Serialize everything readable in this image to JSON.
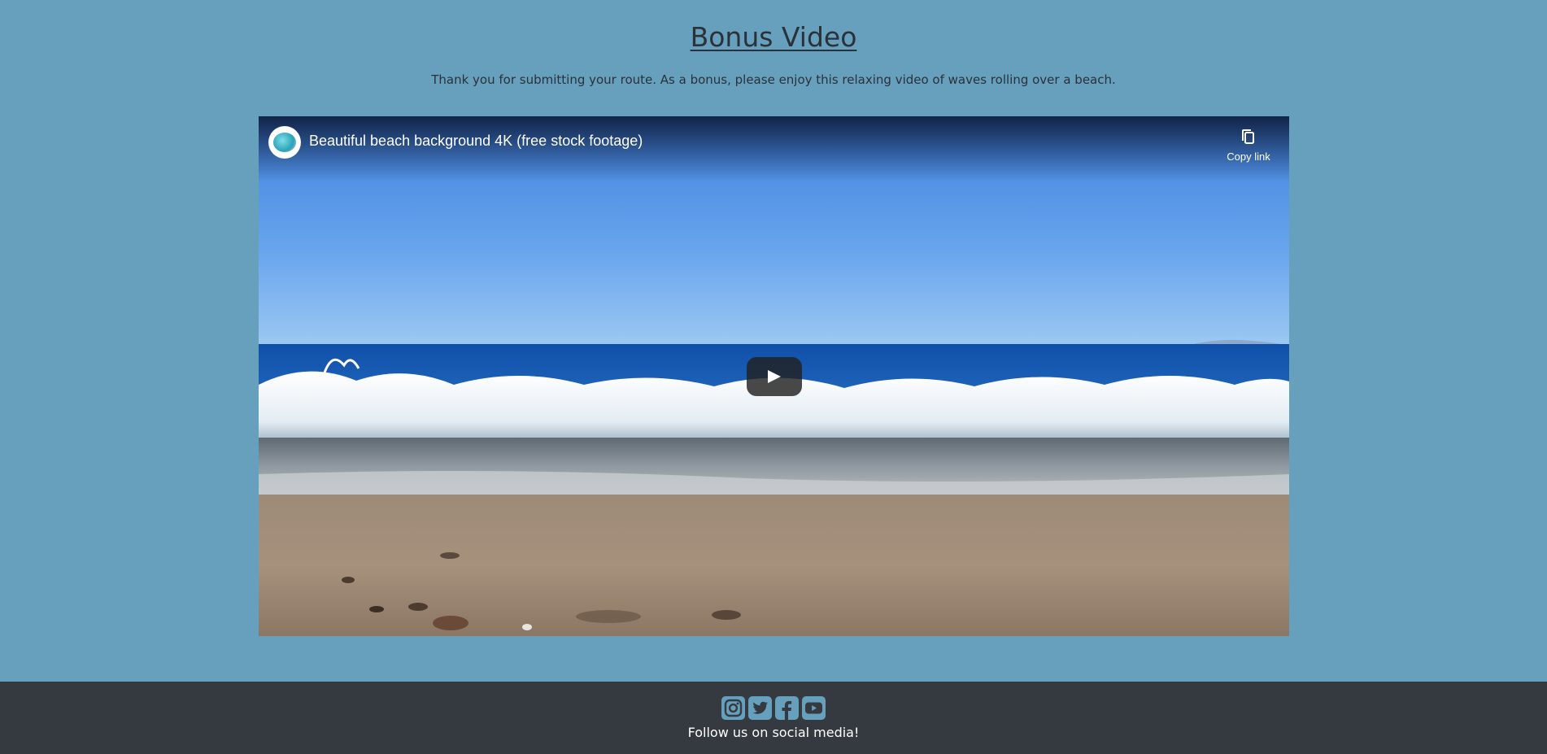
{
  "page": {
    "title": "Bonus Video",
    "subtitle": "Thank you for submitting your route. As a bonus, please enjoy this relaxing video of waves rolling over a beach."
  },
  "video": {
    "title": "Beautiful beach background 4K (free stock footage)",
    "copy_link_label": "Copy link",
    "icons": {
      "avatar": "channel-avatar",
      "copy": "copy-icon",
      "play": "play-icon"
    }
  },
  "footer": {
    "follow_text": "Follow us on social media!",
    "social_icons": [
      "instagram-icon",
      "twitter-icon",
      "facebook-icon",
      "youtube-icon"
    ]
  },
  "colors": {
    "background": "#67a0bd",
    "footer": "#343a40",
    "text": "#2a3139"
  }
}
